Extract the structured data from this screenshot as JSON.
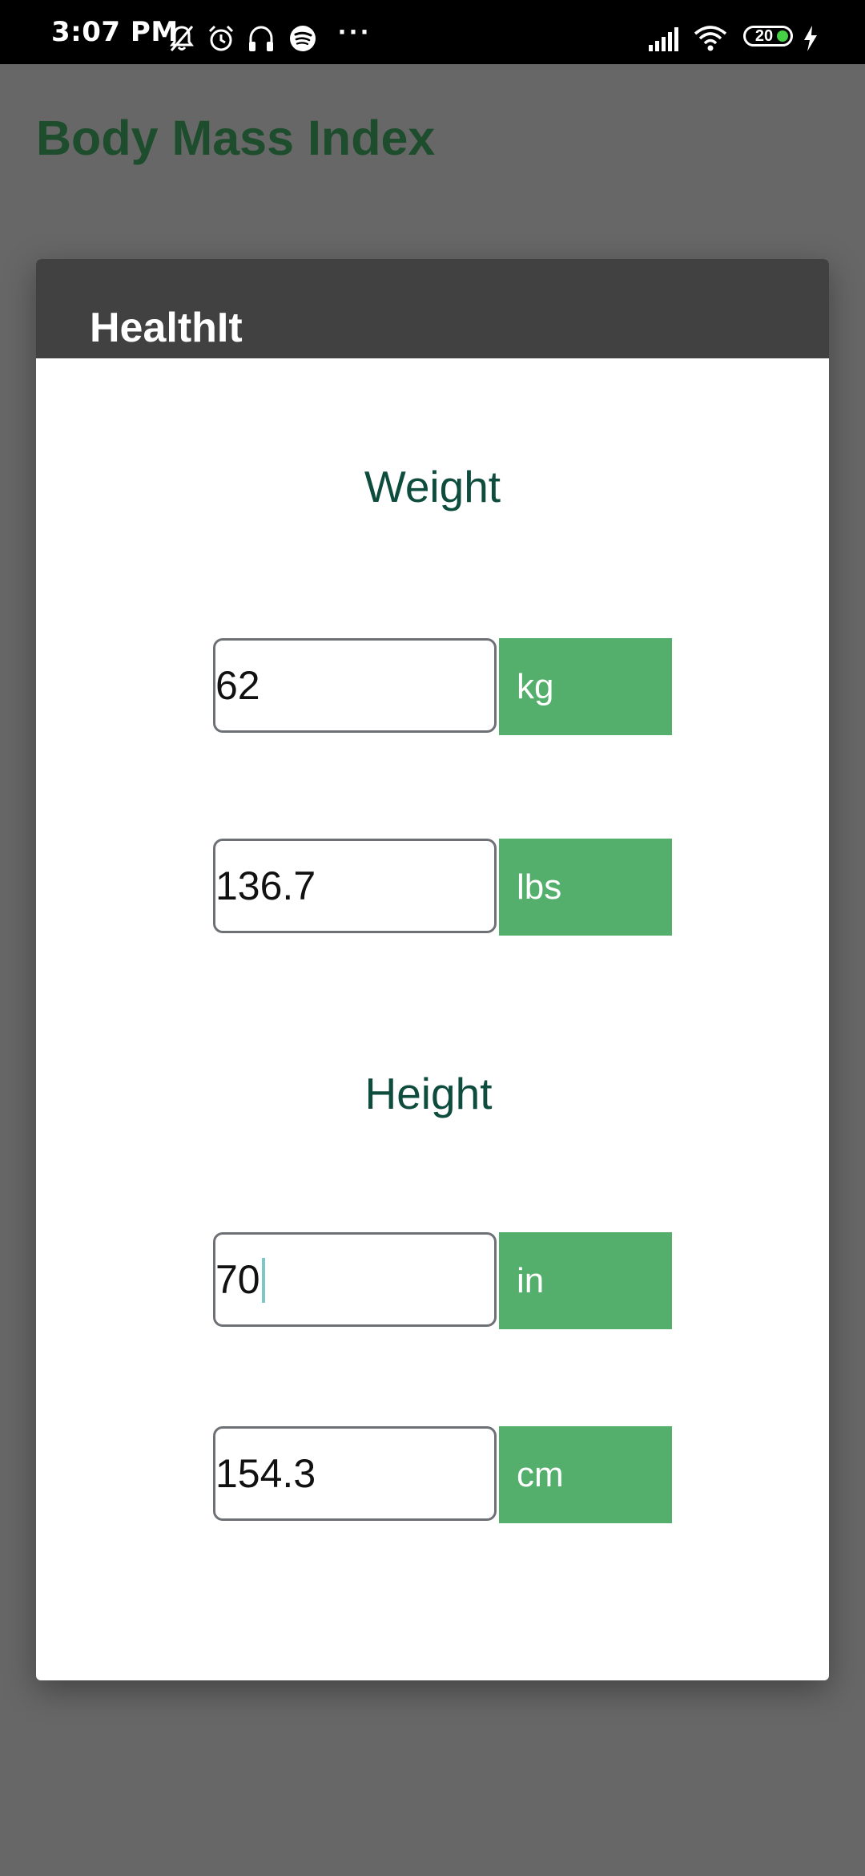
{
  "status_bar": {
    "time": "3:07 PM",
    "more": "···",
    "battery_level": "20",
    "icons": [
      "mute-bell-icon",
      "alarm-icon",
      "headphones-icon",
      "spotify-icon",
      "signal-icon",
      "wifi-icon",
      "battery-icon",
      "charging-icon"
    ]
  },
  "app": {
    "title": "Body Mass Index"
  },
  "dialog": {
    "title": "HealthIt",
    "weight": {
      "label": "Weight",
      "kg_value": "62",
      "kg_unit": "kg",
      "lbs_value": "136.7",
      "lbs_unit": "lbs"
    },
    "height": {
      "label": "Height",
      "in_value": "70",
      "in_unit": "in",
      "cm_value": "154.3",
      "cm_unit": "cm"
    }
  },
  "colors": {
    "title_green": "#1d4d2c",
    "label_teal": "#0e4d3d",
    "unit_green": "#55af6c",
    "header_gray": "#414141",
    "backdrop": "#676767"
  }
}
